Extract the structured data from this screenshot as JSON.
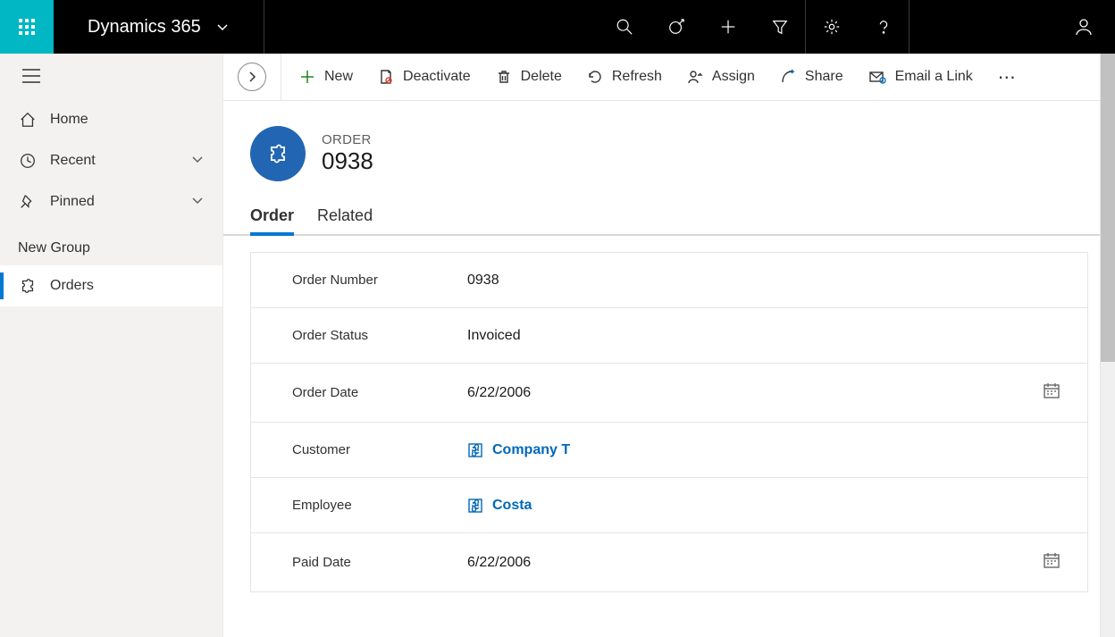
{
  "topbar": {
    "brand": "Dynamics 365"
  },
  "sidebar": {
    "home": "Home",
    "recent": "Recent",
    "pinned": "Pinned",
    "group_label": "New Group",
    "orders": "Orders"
  },
  "commands": {
    "new": "New",
    "deactivate": "Deactivate",
    "delete": "Delete",
    "refresh": "Refresh",
    "assign": "Assign",
    "share": "Share",
    "email_link": "Email a Link"
  },
  "record": {
    "entity_label": "ORDER",
    "title": "0938"
  },
  "tabs": {
    "order": "Order",
    "related": "Related"
  },
  "form": {
    "order_number": {
      "label": "Order Number",
      "value": "0938"
    },
    "order_status": {
      "label": "Order Status",
      "value": "Invoiced"
    },
    "order_date": {
      "label": "Order Date",
      "value": "6/22/2006"
    },
    "customer": {
      "label": "Customer",
      "value": "Company T"
    },
    "employee": {
      "label": "Employee",
      "value": "Costa"
    },
    "paid_date": {
      "label": "Paid Date",
      "value": "6/22/2006"
    }
  }
}
